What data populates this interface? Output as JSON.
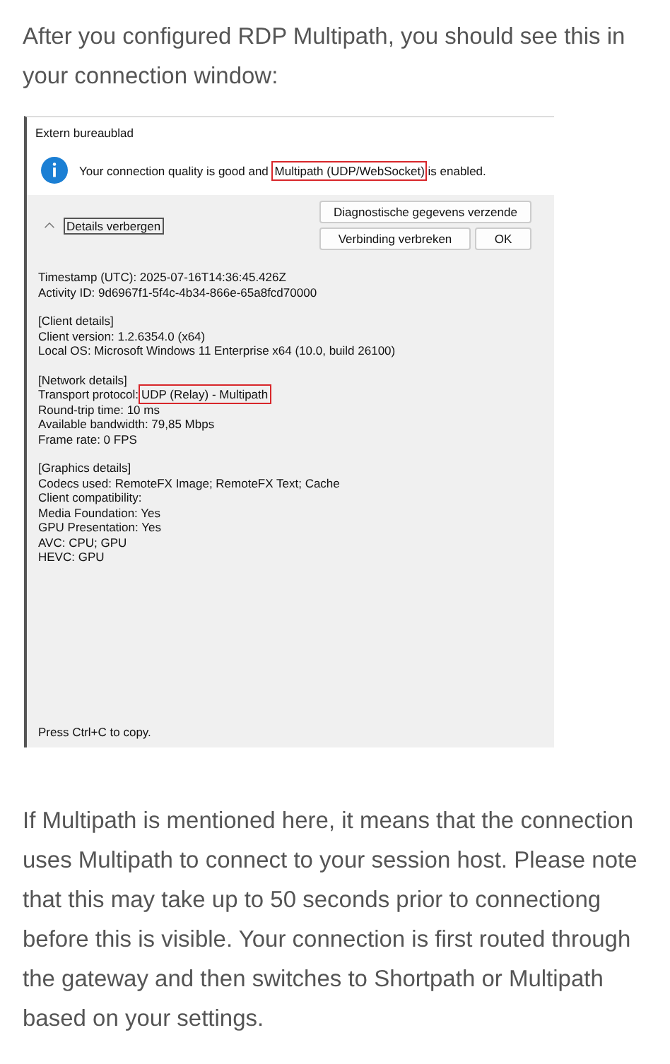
{
  "intro": "After you configured RDP Multipath, you should see this in your connection window:",
  "dialog": {
    "title": "Extern bureaublad",
    "message": {
      "before": "Your connection quality is good and",
      "highlight": "Multipath (UDP/WebSocket)",
      "after": "is enabled."
    },
    "toggle": {
      "label": "Details verbergen",
      "expanded": true
    },
    "buttons": [
      {
        "label": "Diagnostische gegevens verzende",
        "kind": "wide"
      },
      {
        "label": "Verbinding verbreken",
        "kind": "normal"
      },
      {
        "label": "OK",
        "kind": "small"
      }
    ],
    "details": [
      [
        {
          "text": "Timestamp (UTC): 2025-07-16T14:36:45.426Z"
        },
        {
          "text": "Activity ID: 9d6967f1-5f4c-4b34-866e-65a8fcd70000"
        }
      ],
      [
        {
          "text": "[Client details]"
        },
        {
          "text": "Client version: 1.2.6354.0 (x64)"
        },
        {
          "text": "Local OS: Microsoft Windows 11 Enterprise x64 (10.0, build 26100)"
        }
      ],
      [
        {
          "text": "[Network details]"
        },
        {
          "text": "Transport protocol:",
          "highlight": "UDP (Relay) - Multipath"
        },
        {
          "text": "Round-trip time: 10 ms"
        },
        {
          "text": "Available bandwidth: 79,85 Mbps"
        },
        {
          "text": "Frame rate: 0 FPS"
        }
      ],
      [
        {
          "text": "[Graphics details]"
        },
        {
          "text": "Codecs used: RemoteFX Image; RemoteFX Text; Cache"
        },
        {
          "text": "Client compatibility:"
        },
        {
          "text": "Media Foundation: Yes"
        },
        {
          "text": "GPU Presentation: Yes"
        },
        {
          "text": "AVC: CPU; GPU"
        },
        {
          "text": "HEVC: GPU"
        }
      ]
    ],
    "footer": "Press Ctrl+C to copy."
  },
  "outro": "If Multipath is mentioned here, it means that the connection uses Multipath to connect to your session host. Please note that this may take up to 50 seconds prior to connectiong before this is visible. Your connection is first routed through the gateway and then switches to Shortpath or Multipath based on your settings."
}
